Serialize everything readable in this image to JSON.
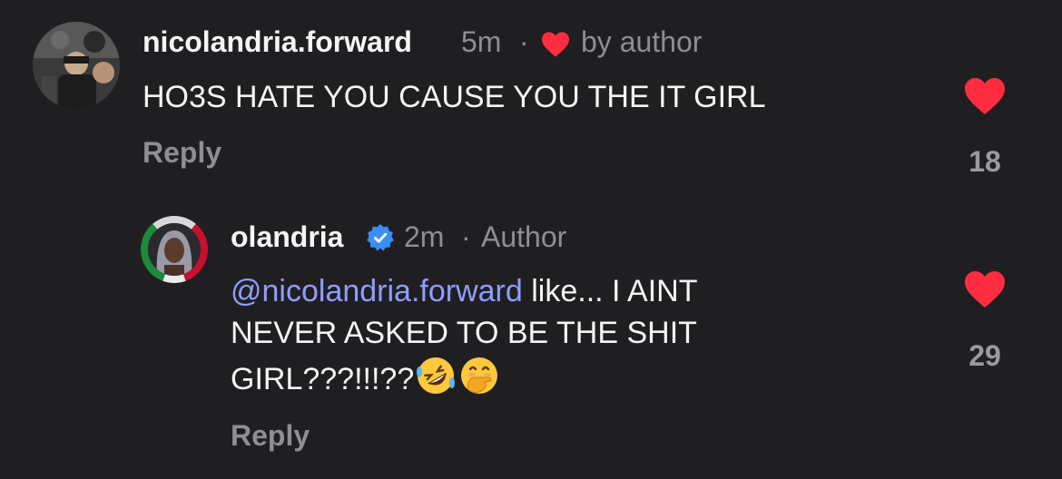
{
  "comment": {
    "username": "nicolandria.forward",
    "time": "5m",
    "separator": "·",
    "liked_by": "by author",
    "text": "HO3S HATE YOU CAUSE YOU THE IT GIRL",
    "reply_label": "Reply",
    "like_count": "18"
  },
  "reply": {
    "username": "olandria",
    "verified_icon": "verified-badge-icon",
    "time": "2m",
    "separator": "·",
    "author_label": "Author",
    "mention": "@nicolandria.forward",
    "text_line1": " like... I AINT",
    "text_line2": "NEVER ASKED TO BE THE SHIT",
    "text_line3": "GIRL???!!!??",
    "emoji1": "rolling-on-floor-laughing-emoji",
    "emoji2": "face-with-hand-over-mouth-emoji",
    "reply_label": "Reply",
    "like_count": "29"
  },
  "colors": {
    "background": "#1f1f21",
    "heart": "#ff2d3f",
    "mention": "#8f9dff",
    "muted": "#8e8e93",
    "verified": "#3b8df7"
  }
}
